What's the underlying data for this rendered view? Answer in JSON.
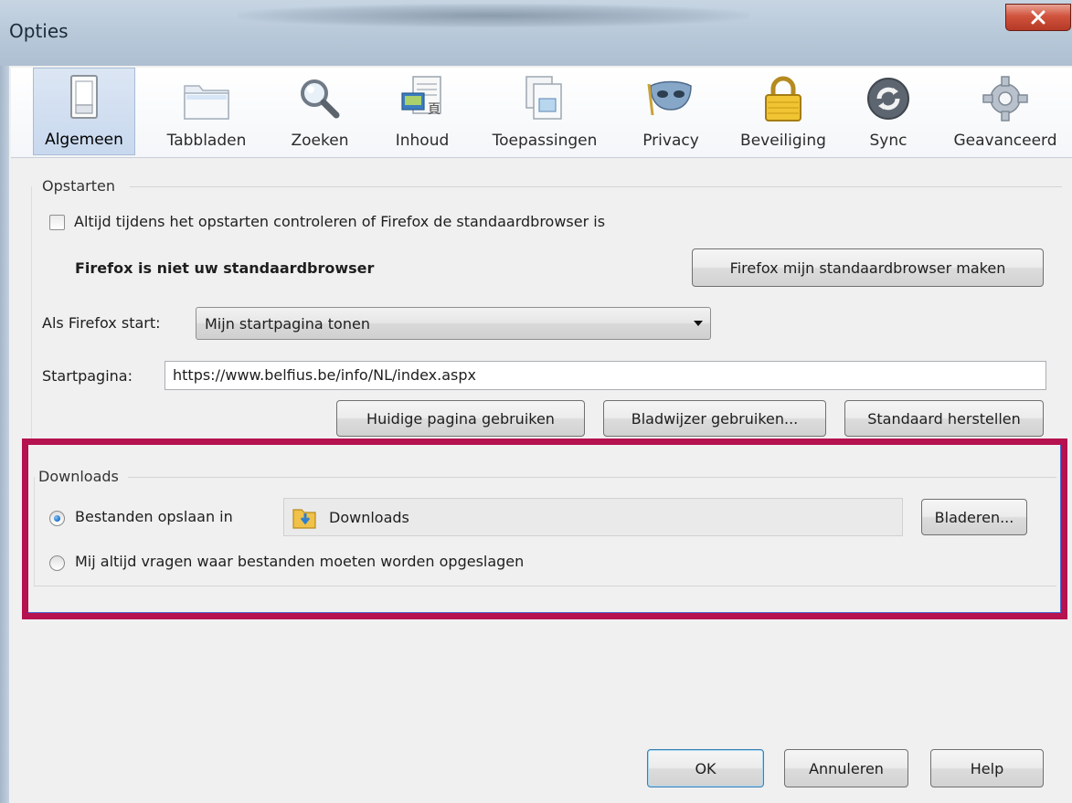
{
  "window": {
    "title": "Opties",
    "close_icon": "close-icon"
  },
  "toolbar": {
    "tabs": [
      {
        "label": "Algemeen",
        "icon": "switch-icon",
        "selected": true
      },
      {
        "label": "Tabbladen",
        "icon": "tabs-folder-icon",
        "selected": false
      },
      {
        "label": "Zoeken",
        "icon": "magnifier-icon",
        "selected": false
      },
      {
        "label": "Inhoud",
        "icon": "content-icon",
        "selected": false
      },
      {
        "label": "Toepassingen",
        "icon": "applications-icon",
        "selected": false
      },
      {
        "label": "Privacy",
        "icon": "mask-icon",
        "selected": false
      },
      {
        "label": "Beveiliging",
        "icon": "padlock-icon",
        "selected": false
      },
      {
        "label": "Sync",
        "icon": "sync-icon",
        "selected": false
      },
      {
        "label": "Geavanceerd",
        "icon": "gear-icon",
        "selected": false
      }
    ]
  },
  "startup": {
    "group_label": "Opstarten",
    "check_default_label": "Altijd tijdens het opstarten controleren of Firefox de standaardbrowser is",
    "check_default_checked": false,
    "status_text": "Firefox is niet uw standaardbrowser",
    "make_default_button": "Firefox mijn standaardbrowser maken",
    "when_starts_label": "Als Firefox start:",
    "when_starts_value": "Mijn startpagina tonen",
    "homepage_label": "Startpagina:",
    "homepage_value": "https://www.belfius.be/info/NL/index.aspx",
    "use_current_button": "Huidige pagina gebruiken",
    "use_bookmark_button": "Bladwijzer gebruiken...",
    "restore_default_button": "Standaard herstellen"
  },
  "downloads": {
    "group_label": "Downloads",
    "save_to_label": "Bestanden opslaan in",
    "save_to_selected": true,
    "folder_value": "Downloads",
    "folder_icon": "download-folder-icon",
    "browse_button": "Bladeren...",
    "always_ask_label": "Mij altijd vragen waar bestanden moeten worden opgeslagen",
    "always_ask_selected": false,
    "highlight_color": "#b5124f"
  },
  "footer": {
    "ok_button": "OK",
    "cancel_button": "Annuleren",
    "help_button": "Help"
  }
}
